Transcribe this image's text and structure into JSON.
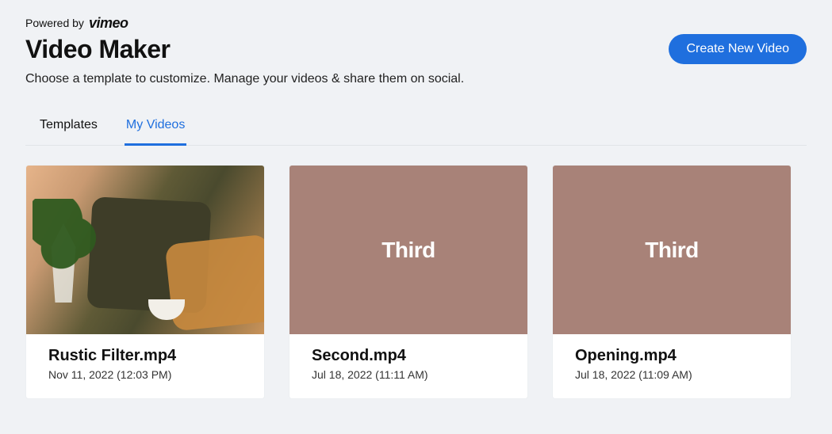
{
  "header": {
    "powered_by_prefix": "Powered by",
    "brand": "vimeo",
    "title": "Video Maker",
    "subtitle": "Choose a template to customize. Manage your videos & share them on social.",
    "create_button": "Create New Video"
  },
  "tabs": [
    {
      "label": "Templates",
      "active": false
    },
    {
      "label": "My Videos",
      "active": true
    }
  ],
  "videos": [
    {
      "title": "Rustic Filter.mp4",
      "date": "Nov 11, 2022 (12:03 PM)",
      "thumb_style": "rustic",
      "overlay_text": ""
    },
    {
      "title": "Second.mp4",
      "date": "Jul 18, 2022 (11:11 AM)",
      "thumb_style": "brown",
      "overlay_text": "Third"
    },
    {
      "title": "Opening.mp4",
      "date": "Jul 18, 2022 (11:09 AM)",
      "thumb_style": "brown",
      "overlay_text": "Third"
    }
  ],
  "colors": {
    "accent": "#1f6fde",
    "page_bg": "#f0f2f5",
    "brown_thumb": "#a88278"
  }
}
